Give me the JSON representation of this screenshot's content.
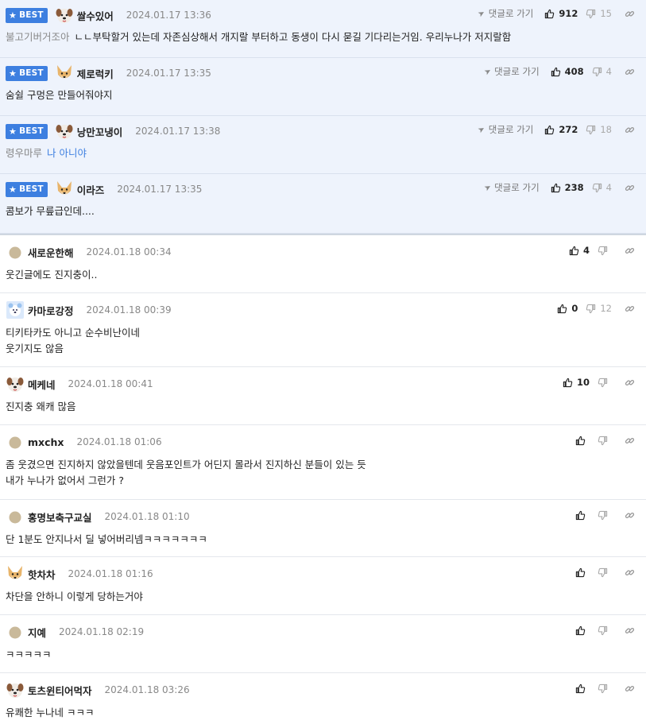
{
  "labels": {
    "best": "BEST",
    "reply_link": "댓글로 가기"
  },
  "colors": {
    "accent": "#3d7fe0",
    "best_bg": "#eef3fc"
  },
  "best_comments": [
    {
      "nick": "쌀수있어",
      "date": "2024.01.17 13:36",
      "avatar": "dog-icon",
      "mention": "불고기버거조아",
      "text": "ㄴㄴ부탁할거 있는데 자존심상해서 개지랄 부터하고 동생이 다시 묻길 기다리는거임. 우리누나가 저지랄함",
      "up": "912",
      "down": "15"
    },
    {
      "nick": "제로럭키",
      "date": "2024.01.17 13:35",
      "avatar": "fox-icon",
      "mention": "",
      "text": "숨쉴 구멍은 만들어줘야지",
      "up": "408",
      "down": "4"
    },
    {
      "nick": "낭만꼬냉이",
      "date": "2024.01.17 13:38",
      "avatar": "dog-icon",
      "mention": "령우마루",
      "text": "나 아니야",
      "up": "272",
      "down": "18"
    },
    {
      "nick": "이라즈",
      "date": "2024.01.17 13:35",
      "avatar": "fox-icon",
      "mention": "",
      "text": "콤보가 무릎급인데....",
      "up": "238",
      "down": "4"
    }
  ],
  "comments": [
    {
      "nick": "새로운한해",
      "date": "2024.01.18 00:34",
      "avatar": "default-avatar-icon",
      "lines": [
        "웃긴글에도 진지충이.."
      ],
      "up": "4",
      "down": ""
    },
    {
      "nick": "카마로강정",
      "date": "2024.01.18 00:39",
      "avatar": "bear-icon",
      "lines": [
        "티키타카도 아니고 순수비난이네",
        "웃기지도 않음"
      ],
      "up": "0",
      "down": "12"
    },
    {
      "nick": "메케네",
      "date": "2024.01.18 00:41",
      "avatar": "dog-icon",
      "lines": [
        "진지충 왜캐 많음"
      ],
      "up": "10",
      "down": ""
    },
    {
      "nick": "mxchx",
      "date": "2024.01.18 01:06",
      "avatar": "default-avatar-icon",
      "lines": [
        "좀 웃겼으면 진지하지 않았을텐데 웃음포인트가 어딘지 몰라서 진지하신 분들이 있는 듯",
        "내가 누나가 없어서 그런가 ?"
      ],
      "up": "",
      "down": ""
    },
    {
      "nick": "홍명보축구교실",
      "date": "2024.01.18 01:10",
      "avatar": "default-avatar-icon",
      "lines": [
        "단 1분도 안지나서 딜 넣어버리넴ㅋㅋㅋㅋㅋㅋㅋ"
      ],
      "up": "",
      "down": ""
    },
    {
      "nick": "핫차차",
      "date": "2024.01.18 01:16",
      "avatar": "fox-icon",
      "lines": [
        "차단을 안하니 이렇게 당하는거야"
      ],
      "up": "",
      "down": ""
    },
    {
      "nick": "지예",
      "date": "2024.01.18 02:19",
      "avatar": "default-avatar-icon",
      "lines": [
        "ㅋㅋㅋㅋㅋ"
      ],
      "up": "",
      "down": ""
    },
    {
      "nick": "토츠윈티어먹자",
      "date": "2024.01.18 03:26",
      "avatar": "dog-icon",
      "lines": [
        "유쾌한 누나네 ㅋㅋㅋ"
      ],
      "up": "",
      "down": ""
    }
  ]
}
